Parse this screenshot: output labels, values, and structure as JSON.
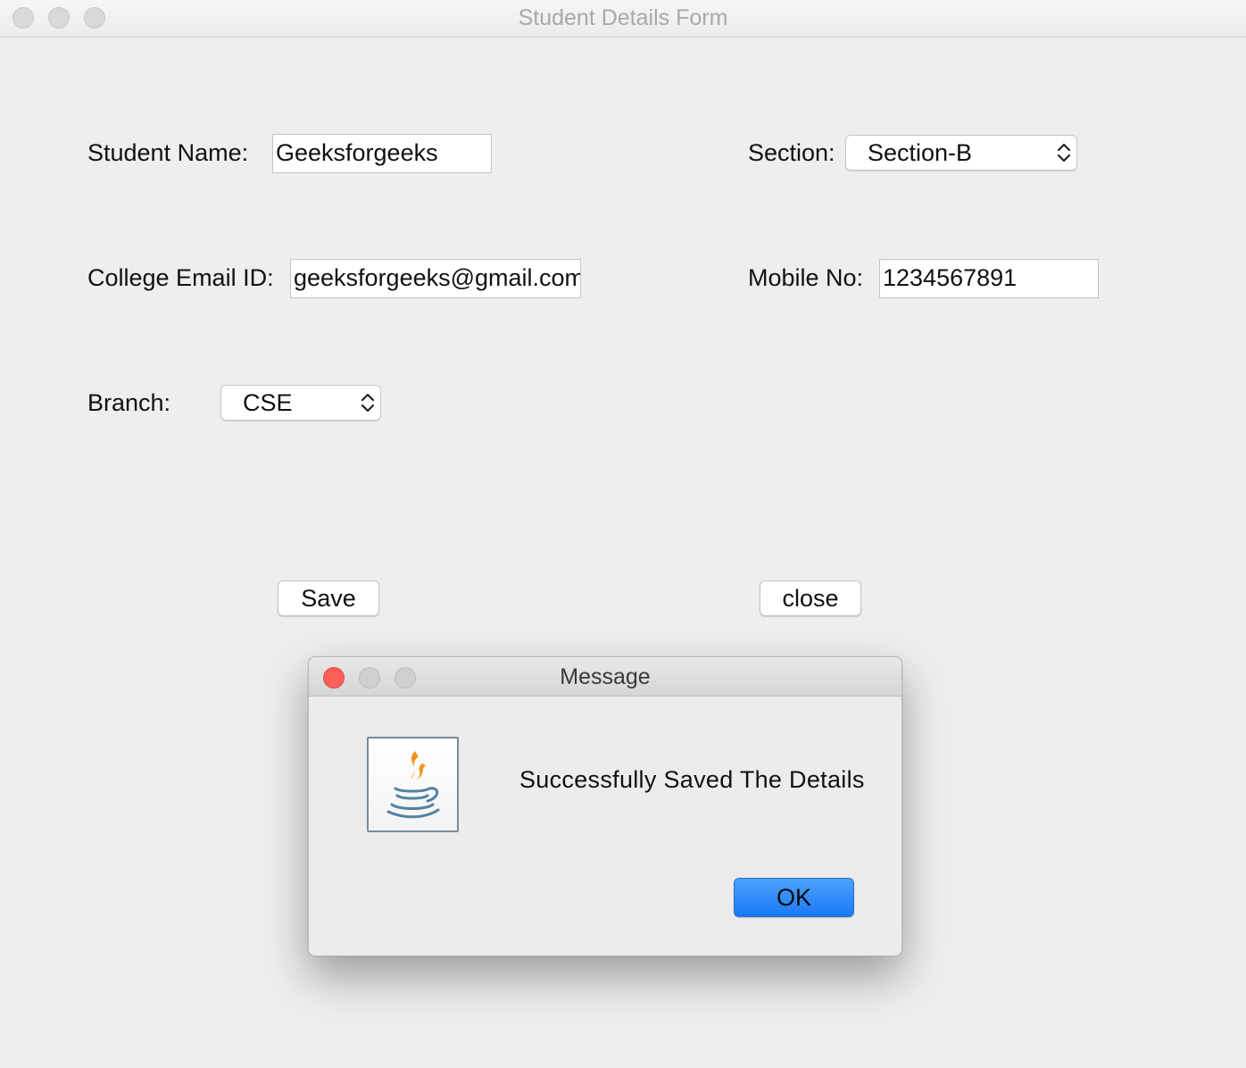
{
  "window": {
    "title": "Student Details Form"
  },
  "form": {
    "student_name_label": "Student Name:",
    "student_name_value": "Geeksforgeeks",
    "section_label": "Section:",
    "section_value": "Section-B",
    "email_label": "College Email ID:",
    "email_value": "geeksforgeeks@gmail.com",
    "mobile_label": "Mobile No:",
    "mobile_value": "1234567891",
    "branch_label": "Branch:",
    "branch_value": "CSE",
    "save_label": "Save",
    "close_label": "close"
  },
  "dialog": {
    "title": "Message",
    "message": "Successfully Saved The Details",
    "ok_label": "OK",
    "icon": "java-cup-icon",
    "colors": {
      "close": "#fc5f57",
      "ok_button": "#1a78f7",
      "java_flame": "#f0951e",
      "java_cup": "#5382a1"
    }
  }
}
